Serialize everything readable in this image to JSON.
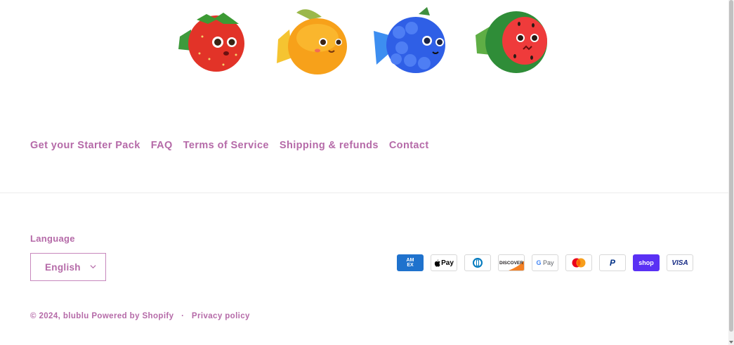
{
  "images": [
    {
      "name": "strawberry-fish",
      "color": "#e8332a"
    },
    {
      "name": "orange-fish",
      "color": "#f7a11a"
    },
    {
      "name": "blueberry-fish",
      "color": "#2f62e6"
    },
    {
      "name": "watermelon-fish",
      "color": "#e23b3b"
    }
  ],
  "footer": {
    "links": [
      "Get your Starter Pack",
      "FAQ",
      "Terms of Service",
      "Shipping & refunds",
      "Contact"
    ],
    "language_label": "Language",
    "language_value": "English",
    "payments": [
      "American Express",
      "Apple Pay",
      "Diners Club",
      "Discover",
      "Google Pay",
      "Mastercard",
      "PayPal",
      "Shop Pay",
      "Visa"
    ],
    "copyright": "© 2024, blublu",
    "powered_by": "Powered by Shopify",
    "separator": "·",
    "privacy": "Privacy policy"
  },
  "colors": {
    "accent": "#b56aa8",
    "border": "#c787bd",
    "shop_pay": "#5a31f4",
    "amex": "#1f72cd"
  }
}
